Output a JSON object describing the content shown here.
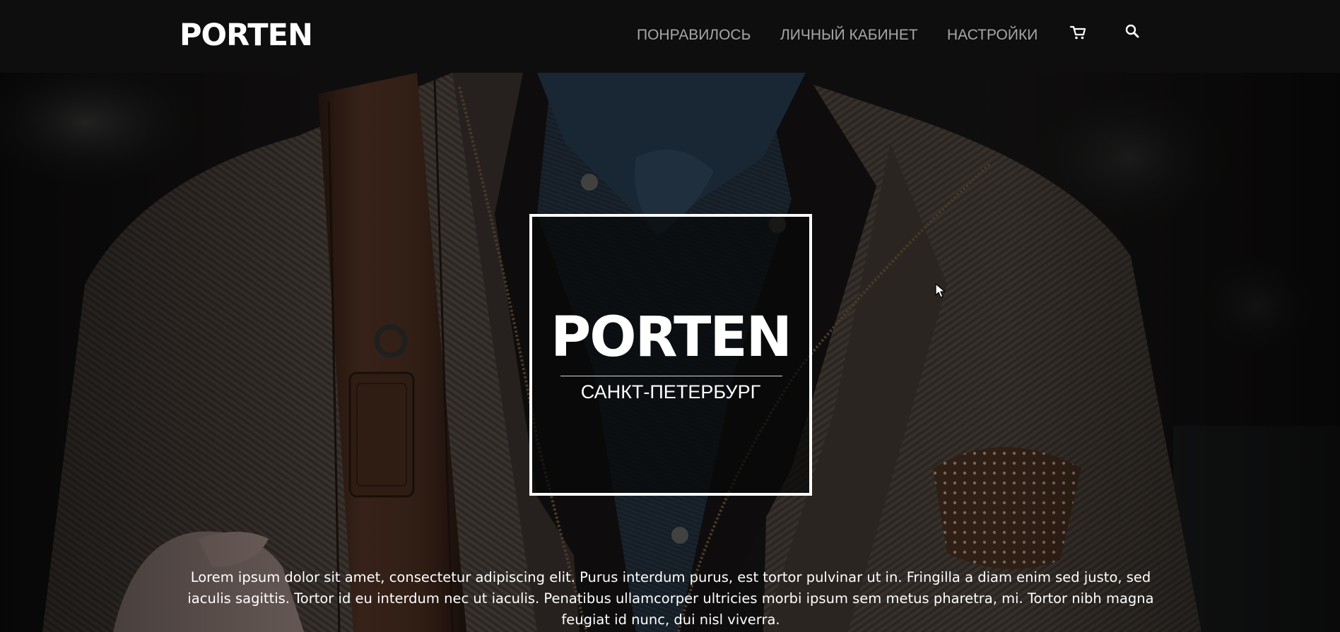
{
  "header": {
    "logo": "PORTEN",
    "nav": [
      {
        "label": "ПОНРАВИЛОСЬ"
      },
      {
        "label": "ЛИЧНЫЙ КАБИНЕТ"
      },
      {
        "label": "НАСТРОЙКИ"
      }
    ],
    "icons": [
      "cart-icon",
      "search-icon"
    ]
  },
  "hero": {
    "title": "PORTEN",
    "subtitle": "САНКТ-ПЕТЕРБУРГ",
    "description": "Lorem ipsum dolor sit amet, consectetur adipiscing elit. Purus interdum purus, est tortor pulvinar ut in. Fringilla a diam enim sed justo, sed iaculis sagittis. Tortor id eu interdum nec ut iaculis. Penatibus ullamcorper ultricies morbi ipsum sem metus pharetra, mi. Tortor nibh magna feugiat id nunc, dui nisl viverra."
  },
  "colors": {
    "header_bg": "#0e0e0e",
    "nav_text": "#a7a7a7",
    "white": "#ffffff"
  }
}
